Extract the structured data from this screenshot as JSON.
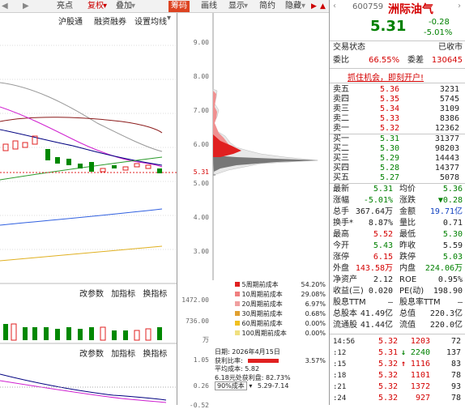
{
  "toolbar": {
    "items": [
      "亮点",
      "复权",
      "叠加",
      "筹码",
      "画线",
      "显示",
      "简约",
      "隐藏"
    ]
  },
  "subbar": {
    "items": [
      "沪股通",
      "融资融券",
      "设置均线"
    ]
  },
  "chart": {
    "price_ticks": [
      "9.00",
      "8.00",
      "7.00",
      "6.00",
      "5.31",
      "5.00",
      "4.00",
      "3.00"
    ],
    "current_price": "5.31",
    "volume_ticks": [
      "1472.00",
      "736.00",
      "万"
    ],
    "macd_ticks": [
      "1.05",
      "0.26",
      "-0.52"
    ],
    "indicator_buttons": [
      "改参数",
      "加指标",
      "换指标"
    ],
    "indicator_buttons2": [
      "改参数",
      "加指标",
      "换指标"
    ]
  },
  "chip_legend": [
    {
      "label": "5周期前成本",
      "value": "54.20%",
      "color": "#e02020"
    },
    {
      "label": "10周期前成本",
      "value": "29.08%",
      "color": "#f08080"
    },
    {
      "label": "20周期前成本",
      "value": "6.97%",
      "color": "#f0a0a0"
    },
    {
      "label": "30周期前成本",
      "value": "0.68%",
      "color": "#e0a030"
    },
    {
      "label": "60周期前成本",
      "value": "0.00%",
      "color": "#f0c020"
    },
    {
      "label": "100周期前成本",
      "value": "0.00%",
      "color": "#f0e080"
    }
  ],
  "chip_info": {
    "date": "日期: 2026年4月15日",
    "profit_ratio_label": "获利比率:",
    "profit_ratio": "3.57%",
    "avg_cost": "平均成本: 5.82",
    "profit_line": "6.18元处获利盘: 82.73%",
    "range_select": "90%成本",
    "range": "5.29-7.14"
  },
  "stock": {
    "code": "600759",
    "name": "洲际油气",
    "price": "5.31",
    "change": "-0.28",
    "change_pct": "-5.01%",
    "status_label": "交易状态",
    "status": "已收市",
    "weibi_label": "委比",
    "weibi": "66.55%",
    "weicha_label": "委差",
    "weicha": "130645",
    "banner": "抓住机会，即刻开户!"
  },
  "sell_orders": [
    {
      "label": "卖五",
      "price": "5.36",
      "vol": "3231"
    },
    {
      "label": "卖四",
      "price": "5.35",
      "vol": "5745"
    },
    {
      "label": "卖三",
      "price": "5.34",
      "vol": "3109"
    },
    {
      "label": "卖二",
      "price": "5.33",
      "vol": "8386"
    },
    {
      "label": "卖一",
      "price": "5.32",
      "vol": "12362"
    }
  ],
  "buy_orders": [
    {
      "label": "买一",
      "price": "5.31",
      "vol": "31377"
    },
    {
      "label": "买二",
      "price": "5.30",
      "vol": "98203"
    },
    {
      "label": "买三",
      "price": "5.29",
      "vol": "14443"
    },
    {
      "label": "买四",
      "price": "5.28",
      "vol": "14377"
    },
    {
      "label": "买五",
      "price": "5.27",
      "vol": "5078"
    }
  ],
  "quote": [
    {
      "l1": "最新",
      "v1": "5.31",
      "c1": "green",
      "l2": "均价",
      "v2": "5.36",
      "c2": "green"
    },
    {
      "l1": "涨幅",
      "v1": "-5.01%",
      "c1": "green",
      "l2": "涨跌",
      "v2": "▼0.28",
      "c2": "green"
    },
    {
      "l1": "总手",
      "v1": "367.64万",
      "c1": "",
      "l2": "金额",
      "v2": "19.71亿",
      "c2": "blue"
    },
    {
      "l1": "换手*",
      "v1": "8.87%",
      "c1": "",
      "l2": "量比",
      "v2": "0.71",
      "c2": ""
    },
    {
      "l1": "最高",
      "v1": "5.52",
      "c1": "red",
      "l2": "最低",
      "v2": "5.30",
      "c2": "green"
    },
    {
      "l1": "今开",
      "v1": "5.43",
      "c1": "green",
      "l2": "昨收",
      "v2": "5.59",
      "c2": ""
    },
    {
      "l1": "涨停",
      "v1": "6.15",
      "c1": "red",
      "l2": "跌停",
      "v2": "5.03",
      "c2": "green"
    },
    {
      "l1": "外盘",
      "v1": "143.58万",
      "c1": "red",
      "l2": "内盘",
      "v2": "224.06万",
      "c2": "green"
    },
    {
      "l1": "净资产",
      "v1": "2.12",
      "c1": "",
      "l2": "ROE",
      "v2": "0.95%",
      "c2": ""
    },
    {
      "l1": "收益(三)",
      "v1": "0.020",
      "c1": "",
      "l2": "PE(动)",
      "v2": "198.90",
      "c2": ""
    },
    {
      "l1": "股息TTM",
      "v1": "—",
      "c1": "",
      "l2": "股息率TTM",
      "v2": "—",
      "c2": ""
    },
    {
      "l1": "总股本",
      "v1": "41.49亿",
      "c1": "",
      "l2": "总值",
      "v2": "220.3亿",
      "c2": ""
    },
    {
      "l1": "流通股",
      "v1": "41.44亿",
      "c1": "",
      "l2": "流值",
      "v2": "220.0亿",
      "c2": ""
    }
  ],
  "ticks": [
    {
      "time": "14:56",
      "price": "5.32",
      "arrow": "",
      "vol": "1203",
      "vc": "red",
      "n": "72"
    },
    {
      "time": ":12",
      "price": "5.31",
      "arrow": "↓",
      "vol": "2240",
      "vc": "green",
      "n": "137"
    },
    {
      "time": ":15",
      "price": "5.32",
      "arrow": "↑",
      "vol": "1116",
      "vc": "red",
      "n": "83"
    },
    {
      "time": ":18",
      "price": "5.32",
      "arrow": "",
      "vol": "1101",
      "vc": "red",
      "n": "78"
    },
    {
      "time": ":21",
      "price": "5.32",
      "arrow": "",
      "vol": "1372",
      "vc": "red",
      "n": "93"
    },
    {
      "time": ":24",
      "price": "5.32",
      "arrow": "",
      "vol": "927",
      "vc": "red",
      "n": "78"
    }
  ]
}
